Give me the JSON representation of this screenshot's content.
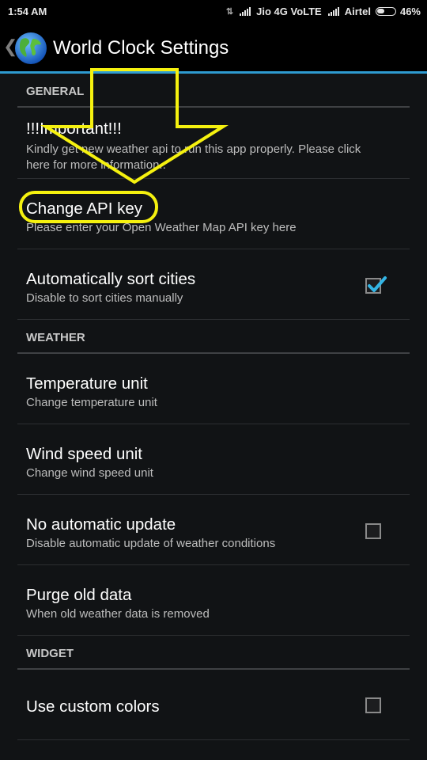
{
  "status_bar": {
    "time": "1:54 AM",
    "carrier1": "Jio 4G VoLTE",
    "carrier2": "Airtel",
    "battery": "46%",
    "battery_level": 0.46
  },
  "app_bar": {
    "title": "World Clock Settings",
    "accent_color": "#2e9bd0"
  },
  "sections": {
    "general": {
      "header": "GENERAL",
      "important_title": "!!!Important!!!",
      "important_summary": "Kindly get new weather api to run this app properly. Please click here for more information..",
      "api_key_title": "Change API key",
      "api_key_summary": "Please enter your Open Weather Map API key here",
      "sort_title": "Automatically sort cities",
      "sort_summary": "Disable to sort cities manually",
      "sort_checked": true
    },
    "weather": {
      "header": "WEATHER",
      "temp_title": "Temperature unit",
      "temp_summary": "Change temperature unit",
      "wind_title": "Wind speed unit",
      "wind_summary": "Change wind speed unit",
      "noupdate_title": "No automatic update",
      "noupdate_summary": "Disable automatic update of weather conditions",
      "noupdate_checked": false,
      "purge_title": "Purge old data",
      "purge_summary": "When old weather data is removed"
    },
    "widget": {
      "header": "WIDGET",
      "custom_colors_title": "Use custom colors",
      "custom_colors_checked": false
    }
  },
  "annotation": {
    "color": "#f5f10f"
  }
}
